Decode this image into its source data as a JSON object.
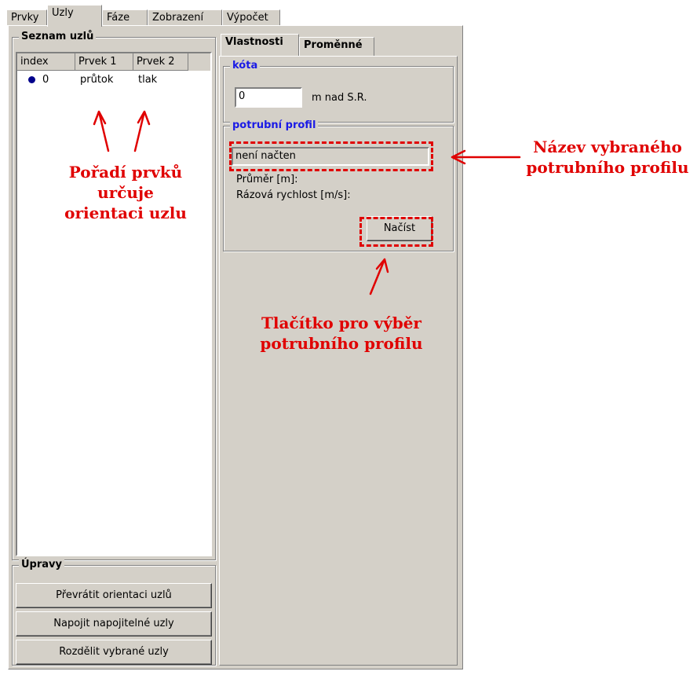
{
  "tabs": [
    {
      "label": "Prvky"
    },
    {
      "label": "Uzly"
    },
    {
      "label": "Fáze"
    },
    {
      "label": "Zobrazení"
    },
    {
      "label": "Výpočet"
    }
  ],
  "node_list": {
    "title": "Seznam uzlů",
    "columns": [
      "index",
      "Prvek 1",
      "Prvek 2"
    ],
    "rows": [
      {
        "index": "0",
        "prvek1": "průtok",
        "prvek2": "tlak"
      }
    ]
  },
  "edits": {
    "title": "Úpravy",
    "buttons": [
      "Převrátit orientaci uzlů",
      "Napojit napojitelné uzly",
      "Rozdělit vybrané uzly"
    ]
  },
  "inner_tabs": [
    {
      "label": "Vlastnosti"
    },
    {
      "label": "Proměnné"
    }
  ],
  "kota": {
    "title": "kóta",
    "value": "0",
    "unit": "m nad S.R."
  },
  "profile": {
    "title": "potrubní profil",
    "name": "není načten",
    "diameter_label": "Průměr [m]:",
    "wave_speed_label": "Rázová rychlost [m/s]:",
    "load_button": "Načíst"
  },
  "annotations": {
    "order": [
      "Pořadí prvků",
      "určuje",
      "orientaci uzlu"
    ],
    "profile_name": [
      "Název vybraného",
      "potrubního profilu"
    ],
    "load_button": [
      "Tlačítko pro výběr",
      "potrubního profilu"
    ]
  },
  "colors": {
    "annotation": "#e00000",
    "group_title_blue": "#1a1ae6",
    "node_dot": "#00008b"
  }
}
